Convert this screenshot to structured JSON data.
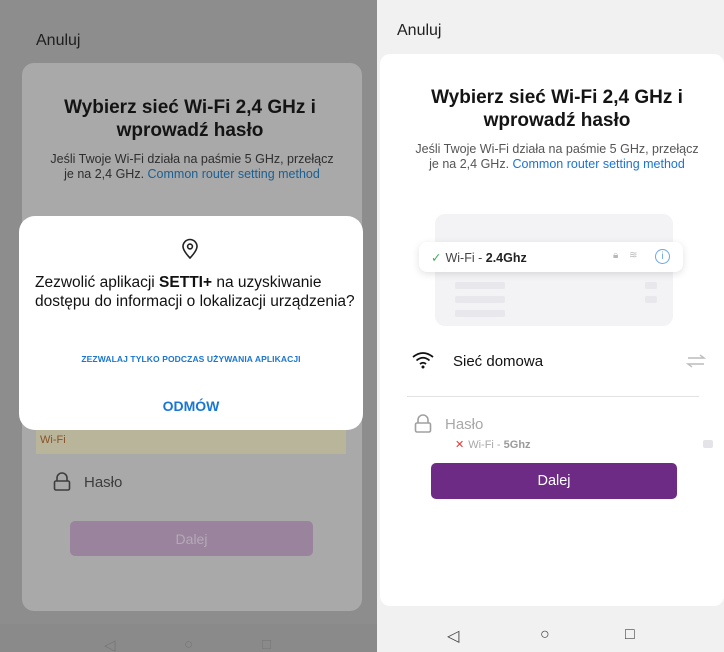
{
  "left_screen": {
    "cancel_label": "Anuluj",
    "title": "Wybierz sieć Wi-Fi 2,4 GHz i wprowadź hasło",
    "subtitle_text": "Jeśli Twoje Wi-Fi działa na paśmie 5 GHz, przełącz je na 2,4 GHz. ",
    "subtitle_link": "Common router setting method",
    "warning_text": "Wi-Fi",
    "password_placeholder": "Hasło",
    "next_label": "Dalej",
    "dialog": {
      "icon": "location-pin-icon",
      "text_before": "Zezwolić aplikacji ",
      "app_name": "SETTI+",
      "text_after": " na uzyskiwanie dostępu do informacji o lokalizacji urządzenia?",
      "allow_label": "ZEZWALAJ TYLKO PODCZAS UŻYWANIA APLIKACJI",
      "deny_label": "ODMÓW"
    }
  },
  "right_screen": {
    "cancel_label": "Anuluj",
    "title": "Wybierz sieć Wi-Fi 2,4 GHz i wprowadź hasło",
    "subtitle_text": "Jeśli Twoje Wi-Fi działa na paśmie 5 GHz, przełącz je na 2,4 GHz. ",
    "subtitle_link": "Common router setting method",
    "illustration": {
      "row_5ghz_prefix": "Wi-Fi - ",
      "row_5ghz_band": "5Ghz",
      "row_24ghz_prefix": "Wi-Fi - ",
      "row_24ghz_band": "2.4Ghz"
    },
    "network_name": "Sieć domowa",
    "password_placeholder": "Hasło",
    "next_label": "Dalej"
  },
  "nav": {
    "back": "◁",
    "home": "○",
    "recents": "□"
  },
  "colors": {
    "accent_purple": "#6e2b86",
    "link_blue": "#1a73d9",
    "dialog_blue": "#1976d2"
  }
}
